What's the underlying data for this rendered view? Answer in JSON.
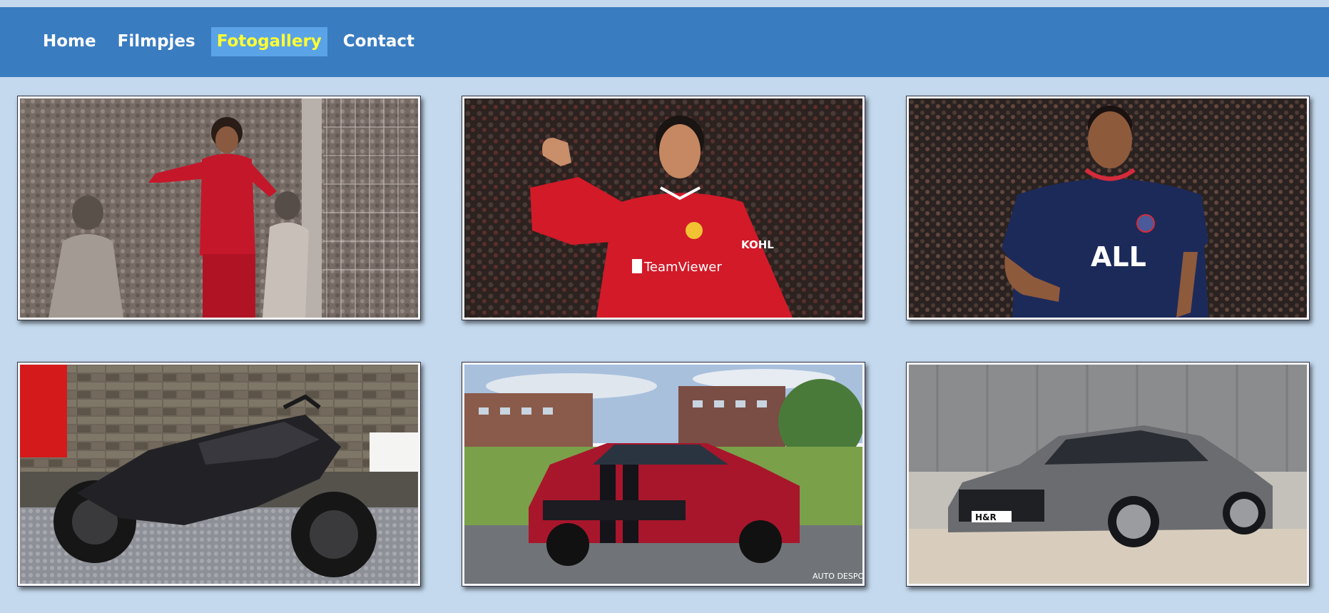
{
  "nav": {
    "items": [
      {
        "label": "Home",
        "active": false
      },
      {
        "label": "Filmpjes",
        "active": false
      },
      {
        "label": "Fotogallery",
        "active": true
      },
      {
        "label": "Contact",
        "active": false
      }
    ]
  },
  "gallery": {
    "photos": [
      {
        "subject": "footballer-red-kit-celebrating",
        "logo_text": ""
      },
      {
        "subject": "footballer-red-kit-thumbs-up",
        "logo_text": "TeamViewer"
      },
      {
        "subject": "footballer-navy-kit",
        "logo_text": "ALL"
      },
      {
        "subject": "black-motorcycle",
        "logo_text": ""
      },
      {
        "subject": "red-muscle-car-black-stripes",
        "logo_text": "AUTO DESPOT"
      },
      {
        "subject": "grey-sedan",
        "logo_text": "H&R"
      }
    ]
  }
}
